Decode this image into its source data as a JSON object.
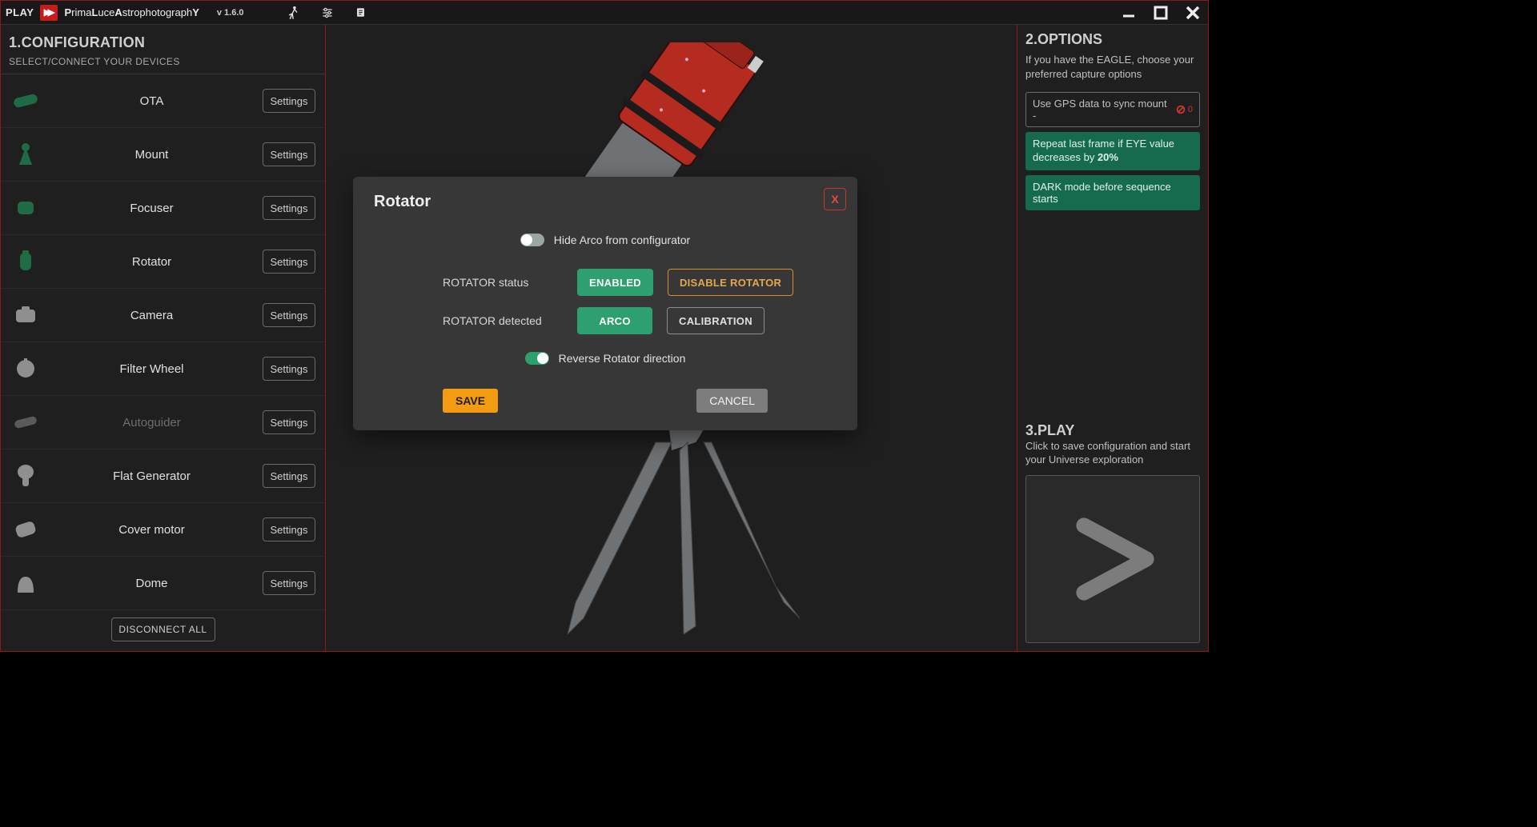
{
  "titlebar": {
    "play_label": "PLAY",
    "brand_html": "PrimaLuceAstrophotographY",
    "version": "v 1.6.0"
  },
  "sidebar": {
    "title": "1.CONFIGURATION",
    "subtitle": "SELECT/CONNECT YOUR DEVICES",
    "settings_label": "Settings",
    "disconnect_label": "DISCONNECT ALL",
    "devices": [
      {
        "name": "OTA",
        "icon": "ota",
        "color": "#1e6b46"
      },
      {
        "name": "Mount",
        "icon": "mount",
        "color": "#1e6b46"
      },
      {
        "name": "Focuser",
        "icon": "focuser",
        "color": "#1e6b46"
      },
      {
        "name": "Rotator",
        "icon": "rotator",
        "color": "#1e6b46"
      },
      {
        "name": "Camera",
        "icon": "camera",
        "color": "#8f8f8f"
      },
      {
        "name": "Filter Wheel",
        "icon": "filter",
        "color": "#8f8f8f"
      },
      {
        "name": "Autoguider",
        "icon": "autoguider",
        "color": "#5a5a5a",
        "disabled": true
      },
      {
        "name": "Flat Generator",
        "icon": "flat",
        "color": "#8f8f8f"
      },
      {
        "name": "Cover motor",
        "icon": "cover",
        "color": "#8f8f8f"
      },
      {
        "name": "Dome",
        "icon": "dome",
        "color": "#8f8f8f"
      }
    ]
  },
  "rightpanel": {
    "title": "2.OPTIONS",
    "desc": "If you have the EAGLE, choose your preferred capture options",
    "gps_btn": "Use GPS data to sync mount  -",
    "gps_suffix": "0",
    "repeat_prefix": "Repeat last frame if EYE value decreases by ",
    "repeat_bold": "20%",
    "dark_btn": "DARK mode before sequence starts",
    "section3_title": "3.PLAY",
    "section3_desc": "Click to save configuration and start your Universe exploration"
  },
  "modal": {
    "title": "Rotator",
    "close_label": "X",
    "hide_arco_label": "Hide Arco from configurator",
    "hide_arco_on": false,
    "status_label": "ROTATOR status",
    "status_value": "ENABLED",
    "disable_label": "DISABLE ROTATOR",
    "detected_label": "ROTATOR detected",
    "detected_value": "ARCO",
    "calibration_label": "CALIBRATION",
    "reverse_label": "Reverse Rotator direction",
    "reverse_on": true,
    "save_label": "SAVE",
    "cancel_label": "CANCEL"
  }
}
